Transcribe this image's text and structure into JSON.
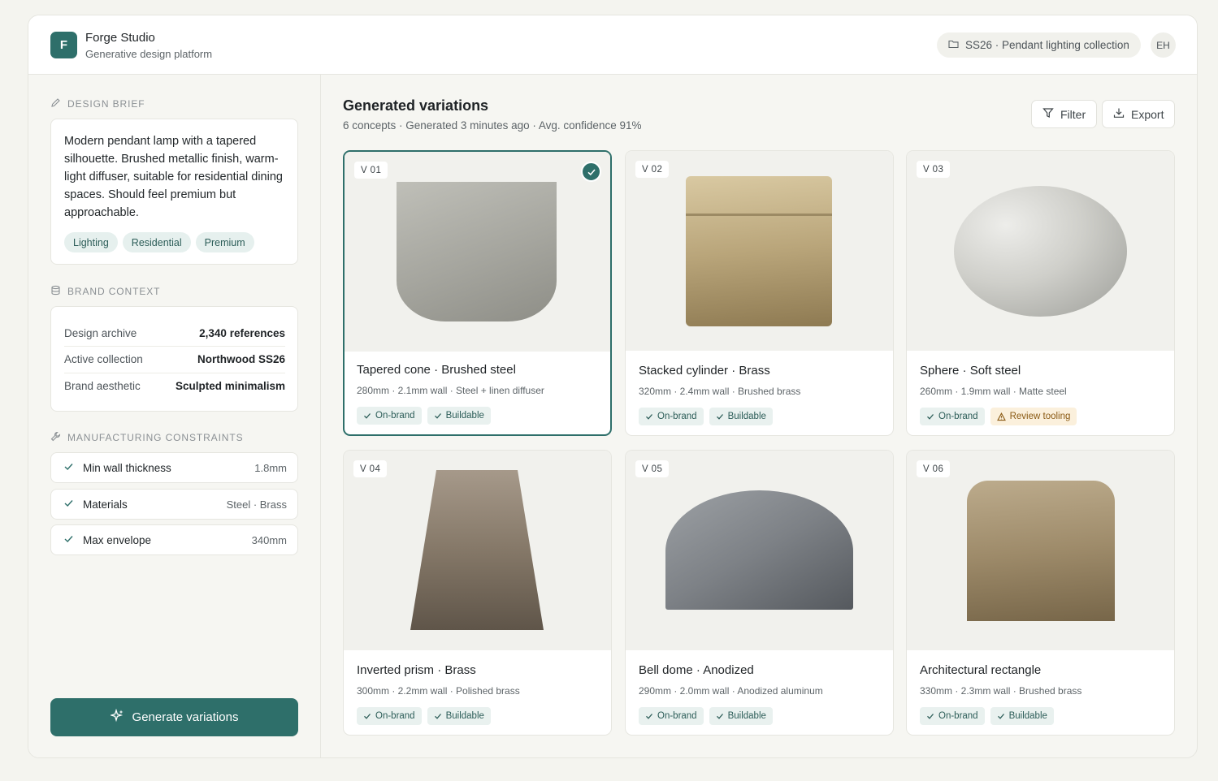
{
  "header": {
    "logo_letter": "F",
    "app_name": "Forge Studio",
    "app_subtitle": "Generative design platform",
    "project": "SS26 · Pendant lighting collection",
    "user_initials": "EH"
  },
  "sidebar": {
    "brief": {
      "title": "DESIGN BRIEF",
      "text": "Modern pendant lamp with a tapered silhouette. Brushed metallic finish, warm-light diffuser, suitable for residential dining spaces. Should feel premium but approachable.",
      "tags": [
        "Lighting",
        "Residential",
        "Premium"
      ]
    },
    "brand": {
      "title": "BRAND CONTEXT",
      "rows": [
        {
          "label": "Design archive",
          "value": "2,340 references"
        },
        {
          "label": "Active collection",
          "value": "Northwood SS26"
        },
        {
          "label": "Brand aesthetic",
          "value": "Sculpted minimalism"
        }
      ]
    },
    "constraints": {
      "title": "MANUFACTURING CONSTRAINTS",
      "items": [
        {
          "label": "Min wall thickness",
          "value": "1.8mm"
        },
        {
          "label": "Materials",
          "value": "Steel · Brass"
        },
        {
          "label": "Max envelope",
          "value": "340mm"
        }
      ]
    },
    "generate_label": "Generate variations"
  },
  "main": {
    "title": "Generated variations",
    "subtitle": "6 concepts · Generated 3 minutes ago · Avg. confidence 91%",
    "filter_label": "Filter",
    "export_label": "Export",
    "variations": [
      {
        "badge": "V 01",
        "title": "Tapered cone · Brushed steel",
        "spec": "280mm · 2.1mm wall · Steel + linen diffuser",
        "tags": [
          {
            "label": "On-brand",
            "kind": "ok"
          },
          {
            "label": "Buildable",
            "kind": "ok"
          }
        ],
        "selected": true
      },
      {
        "badge": "V 02",
        "title": "Stacked cylinder · Brass",
        "spec": "320mm · 2.4mm wall · Brushed brass",
        "tags": [
          {
            "label": "On-brand",
            "kind": "ok"
          },
          {
            "label": "Buildable",
            "kind": "ok"
          }
        ],
        "selected": false
      },
      {
        "badge": "V 03",
        "title": "Sphere · Soft steel",
        "spec": "260mm · 1.9mm wall · Matte steel",
        "tags": [
          {
            "label": "On-brand",
            "kind": "ok"
          },
          {
            "label": "Review tooling",
            "kind": "warn"
          }
        ],
        "selected": false
      },
      {
        "badge": "V 04",
        "title": "Inverted prism · Brass",
        "spec": "300mm · 2.2mm wall · Polished brass",
        "tags": [
          {
            "label": "On-brand",
            "kind": "ok"
          },
          {
            "label": "Buildable",
            "kind": "ok"
          }
        ],
        "selected": false
      },
      {
        "badge": "V 05",
        "title": "Bell dome · Anodized",
        "spec": "290mm · 2.0mm wall · Anodized aluminum",
        "tags": [
          {
            "label": "On-brand",
            "kind": "ok"
          },
          {
            "label": "Buildable",
            "kind": "ok"
          }
        ],
        "selected": false
      },
      {
        "badge": "V 06",
        "title": "Architectural rectangle",
        "spec": "330mm · 2.3mm wall · Brushed brass",
        "tags": [
          {
            "label": "On-brand",
            "kind": "ok"
          },
          {
            "label": "Buildable",
            "kind": "ok"
          }
        ],
        "selected": false
      }
    ]
  },
  "colors": {
    "accent": "#2e6f6a",
    "tag_bg": "#e6f0ee",
    "warn_bg": "#fbf0dc"
  }
}
